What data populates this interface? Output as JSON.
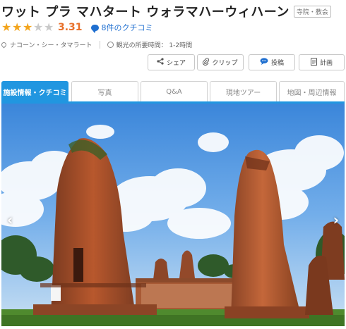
{
  "header": {
    "title": "ワット プラ マハタート ウォラマハーウィハーン",
    "category": "寺院・教会"
  },
  "rating": {
    "stars_full": 3,
    "stars_total": 5,
    "score": "3.31",
    "reviews": "8件のクチコミ",
    "star_color": "#f3a41c",
    "score_color": "#e8702a"
  },
  "info": {
    "location": "ナコーン・シー・タマラート",
    "time": "観光の所要時間： 1-2時間"
  },
  "actions": [
    {
      "label": "シェア",
      "icon": "share-icon"
    },
    {
      "label": "クリップ",
      "icon": "clip-icon"
    },
    {
      "label": "投稿",
      "icon": "post-bubble-icon"
    },
    {
      "label": "計画",
      "icon": "plan-icon"
    }
  ],
  "tabs": [
    {
      "label": "施設情報・クチコミ",
      "active": true
    },
    {
      "label": "写真",
      "active": false
    },
    {
      "label": "Q&A",
      "active": false
    },
    {
      "label": "現地ツアー",
      "active": false
    },
    {
      "label": "地図・周辺情報",
      "active": false
    }
  ],
  "gallery": {
    "prev_arrow": "‹",
    "next_arrow": "›",
    "accent_color": "#2196e0"
  }
}
